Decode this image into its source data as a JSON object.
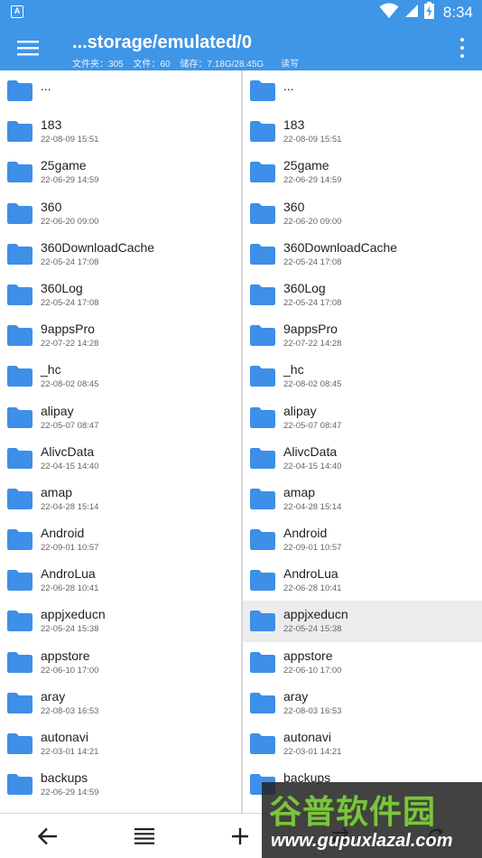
{
  "status_bar": {
    "app_icon_letter": "A",
    "time": "8:34",
    "icons": [
      "wifi-icon",
      "cell-signal-icon",
      "battery-charging-icon"
    ]
  },
  "toolbar": {
    "title": "...storage/emulated/0",
    "folders": "文件夹：305",
    "files": "文件：60",
    "storage": "储存：7.18G/28.45G",
    "mode": "读写"
  },
  "left_pane": {
    "parent_label": "...",
    "items": [
      {
        "name": "183",
        "date": "22-08-09 15:51"
      },
      {
        "name": "25game",
        "date": "22-06-29 14:59"
      },
      {
        "name": "360",
        "date": "22-06-20 09:00"
      },
      {
        "name": "360DownloadCache",
        "date": "22-05-24 17:08"
      },
      {
        "name": "360Log",
        "date": "22-05-24 17:08"
      },
      {
        "name": "9appsPro",
        "date": "22-07-22 14:28"
      },
      {
        "name": "_hc",
        "date": "22-08-02 08:45"
      },
      {
        "name": "alipay",
        "date": "22-05-07 08:47"
      },
      {
        "name": "AlivcData",
        "date": "22-04-15 14:40"
      },
      {
        "name": "amap",
        "date": "22-04-28 15:14"
      },
      {
        "name": "Android",
        "date": "22-09-01 10:57"
      },
      {
        "name": "AndroLua",
        "date": "22-06-28 10:41"
      },
      {
        "name": "appjxeducn",
        "date": "22-05-24 15:38"
      },
      {
        "name": "appstore",
        "date": "22-06-10 17:00"
      },
      {
        "name": "aray",
        "date": "22-08-03 16:53"
      },
      {
        "name": "autonavi",
        "date": "22-03-01 14:21"
      },
      {
        "name": "backups",
        "date": "22-06-29 14:59"
      }
    ]
  },
  "right_pane": {
    "parent_label": "...",
    "selected_index": 12,
    "items": [
      {
        "name": "183",
        "date": "22-08-09 15:51"
      },
      {
        "name": "25game",
        "date": "22-06-29 14:59"
      },
      {
        "name": "360",
        "date": "22-06-20 09:00"
      },
      {
        "name": "360DownloadCache",
        "date": "22-05-24 17:08"
      },
      {
        "name": "360Log",
        "date": "22-05-24 17:08"
      },
      {
        "name": "9appsPro",
        "date": "22-07-22 14:28"
      },
      {
        "name": "_hc",
        "date": "22-08-02 08:45"
      },
      {
        "name": "alipay",
        "date": "22-05-07 08:47"
      },
      {
        "name": "AlivcData",
        "date": "22-04-15 14:40"
      },
      {
        "name": "amap",
        "date": "22-04-28 15:14"
      },
      {
        "name": "Android",
        "date": "22-09-01 10:57"
      },
      {
        "name": "AndroLua",
        "date": "22-06-28 10:41"
      },
      {
        "name": "appjxeducn",
        "date": "22-05-24 15:38"
      },
      {
        "name": "appstore",
        "date": "22-06-10 17:00"
      },
      {
        "name": "aray",
        "date": "22-08-03 16:53"
      },
      {
        "name": "autonavi",
        "date": "22-03-01 14:21"
      },
      {
        "name": "backups",
        "date": ""
      }
    ]
  },
  "bottom_bar": {
    "buttons": [
      "back-arrow-icon",
      "list-view-icon",
      "add-icon",
      "swap-icon",
      "refresh-icon"
    ]
  },
  "watermark": {
    "logo": "谷普软件园",
    "url": "www.gupuxlazal.com"
  },
  "colors": {
    "primary": "#3f95e6",
    "folder": "#3d8fe8",
    "selected_row": "#ececec"
  }
}
